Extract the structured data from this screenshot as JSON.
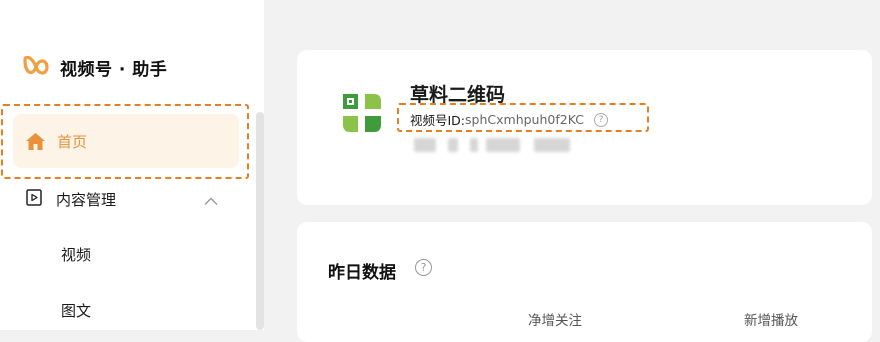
{
  "brand": {
    "name": "视频号 · 助手",
    "logo_icon": "infinity-logo-icon",
    "color": "#f0a040"
  },
  "sidebar": {
    "items": [
      {
        "label": "首页",
        "icon": "home-icon",
        "active": true
      },
      {
        "label": "内容管理",
        "icon": "play-square-icon",
        "expanded": true
      },
      {
        "label": "视频"
      },
      {
        "label": "图文"
      }
    ]
  },
  "account": {
    "name": "草料二维码",
    "id_label": "视频号ID:",
    "id_value": "sphCxmhpuh0f2KC",
    "help_icon": "question-circle-icon"
  },
  "stats": {
    "title": "昨日数据",
    "help_icon": "question-circle-icon",
    "columns": [
      "净增关注",
      "新增播放"
    ]
  },
  "colors": {
    "accent": "#e8923a",
    "active_bg": "#fdf3e7",
    "highlight_outline": "#e67e22"
  }
}
